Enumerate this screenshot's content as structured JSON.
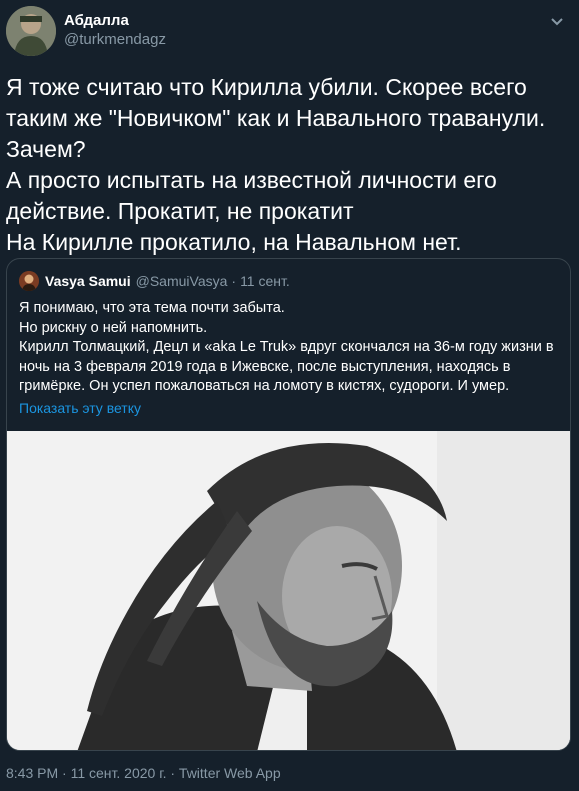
{
  "author": {
    "display_name": "Абдалла",
    "handle": "@turkmendagz"
  },
  "tweet": {
    "text": "Я тоже считаю что Кирилла убили. Скорее всего таким же \"Новичком\" как и Навального траванули. Зачем?\nА просто испытать на известной личности его действие. Прокатит, не прокатит\nНа Кирилле прокатило, на Навальном нет."
  },
  "quote": {
    "display_name": "Vasya Samui",
    "handle": "@SamuiVasya",
    "separator": "·",
    "date": "11 сент.",
    "text": "Я понимаю, что эта тема почти забыта.\nНо рискну о ней напомнить.\nКирилл Толмацкий, Децл и «aka Le Truk» вдруг скончался на 36-м году жизни в ночь на 3 февраля 2019 года в Ижевске, после выступления, находясь в гримёрке. Он успел пожаловаться на ломоту в кистях, судороги. И умер.",
    "show_thread_link": "Показать эту ветку"
  },
  "footer": {
    "meta": "8:43 PM · 11 сент. 2020 г. · Twitter Web App"
  },
  "icons": {
    "menu": "chevron-down-icon"
  },
  "colors": {
    "background": "#15202b",
    "secondary_text": "#8899a6",
    "link": "#1b95e0",
    "border": "#38444d"
  }
}
